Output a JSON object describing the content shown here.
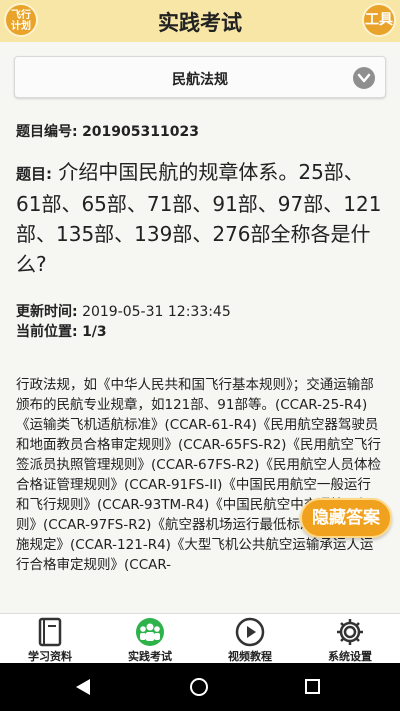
{
  "header": {
    "title": "实践考试",
    "left_badge": "飞行\n计划",
    "right_badge": "工具"
  },
  "selector": {
    "value": "民航法规"
  },
  "question_meta": {
    "id_label": "题目编号:",
    "id_value": "201905311023"
  },
  "question": {
    "label": "题目:",
    "text": "介绍中国民航的规章体系。25部、61部、65部、71部、91部、97部、121部、135部、139部、276部全称各是什么?"
  },
  "info": {
    "updated_label": "更新时间:",
    "updated_value": "2019-05-31 12:33:45",
    "position_label": "当前位置:",
    "position_value": "1/3"
  },
  "answer": {
    "text": "行政法规，如《中华人民共和国飞行基本规则》；交通运输部颁布的民航专业规章，如121部、91部等。(CCAR-25-R4)《运输类飞机适航标准》(CCAR-61-R4)《民用航空器驾驶员和地面教员合格审定规则》(CCAR-65FS-R2)《民用航空飞行签派员执照管理规则》(CCAR-67FS-R2)《民用航空人员体检合格证管理规则》(CCAR-91FS-II)《中国民用航空一般运行和飞行规则》(CCAR-93TM-R4)《中国民航空中交通管理规则》(CCAR-97FS-R2)《航空器机场运行最低标准的制定与实施规定》(CCAR-121-R4)《大型飞机公共航空运输承运人运行合格审定规则》(CCAR-"
  },
  "hide_button": {
    "label": "隐藏答案"
  },
  "tabs": [
    {
      "label": "学习资料",
      "icon": "book-icon"
    },
    {
      "label": "实践考试",
      "icon": "group-icon"
    },
    {
      "label": "视频教程",
      "icon": "play-icon"
    },
    {
      "label": "系统设置",
      "icon": "gear-icon"
    }
  ],
  "colors": {
    "header_bg": "#f7e6a6",
    "accent": "#f0a21f",
    "active_tab": "#2db34a"
  }
}
